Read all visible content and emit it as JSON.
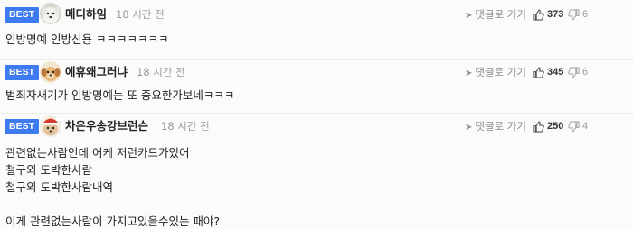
{
  "comments": [
    {
      "badge": "BEST",
      "nickname": "메디하임",
      "time": "18 시간 전",
      "reply_label": "댓글로 가기",
      "likes": "373",
      "dislikes": "6",
      "avatar": "white-dog-avatar",
      "lines": [
        "인방명예 인방신용 ㅋㅋㅋㅋㅋㅋㅋ"
      ]
    },
    {
      "badge": "BEST",
      "nickname": "에휴왜그러냐",
      "time": "18 시간 전",
      "reply_label": "댓글로 가기",
      "likes": "345",
      "dislikes": "6",
      "avatar": "puppy-avatar",
      "lines": [
        "범죄자새기가 인방명예는 또 중요한가보네ㅋㅋㅋ"
      ]
    },
    {
      "badge": "BEST",
      "nickname": "차은우송강브런슨",
      "time": "18 시간 전",
      "reply_label": "댓글로 가기",
      "likes": "250",
      "dislikes": "4",
      "avatar": "santa-dog-avatar",
      "lines": [
        "관련없는사람인데 어케 저런카드가있어",
        "철구외 도박한사람",
        "철구외 도박한사람내역",
        "",
        "이게 관련없는사람이 가지고있을수있는 패야?"
      ]
    }
  ],
  "colors": {
    "best_badge": "#3f7bf0",
    "row_background": "#fbfbfb",
    "divider": "#ececec"
  }
}
